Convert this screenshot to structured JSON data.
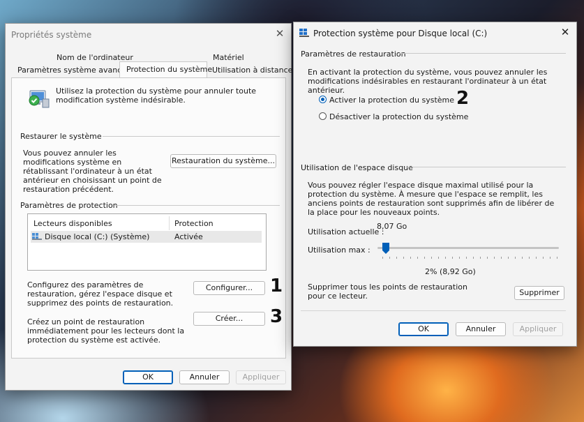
{
  "left_window": {
    "title": "Propriétés système",
    "tabs_row1": [
      "Nom de l'ordinateur",
      "Matériel"
    ],
    "tabs_row2": [
      "Paramètres système avancés",
      "Protection du système",
      "Utilisation à distance"
    ],
    "intro_text": "Utilisez la protection du système pour annuler toute modification système indésirable.",
    "restore_section": {
      "header": "Restaurer le système",
      "text": "Vous pouvez annuler les modifications système en rétablissant l'ordinateur à un état antérieur en choisissant un point de restauration précédent.",
      "button": "Restauration du système..."
    },
    "protection_section": {
      "header": "Paramètres de protection",
      "columns": [
        "Lecteurs disponibles",
        "Protection"
      ],
      "rows": [
        {
          "drive": "Disque local (C:) (Système)",
          "protection": "Activée"
        }
      ]
    },
    "configure_text": "Configurez des paramètres de restauration, gérez l'espace disque et supprimez des points de restauration.",
    "configure_button": "Configurer...",
    "configure_marker": "1",
    "create_text": "Créez un point de restauration immédiatement pour les lecteurs dont la protection du système est activée.",
    "create_button": "Créer...",
    "create_marker": "3",
    "footer": {
      "ok": "OK",
      "cancel": "Annuler",
      "apply": "Appliquer"
    }
  },
  "right_window": {
    "title": "Protection système pour Disque local (C:)",
    "restore_params": {
      "header": "Paramètres de restauration",
      "text": "En activant la protection du système, vous pouvez annuler les modifications indésirables en restaurant l'ordinateur à un état antérieur.",
      "option_on": "Activer la protection du système",
      "option_off": "Désactiver la protection du système",
      "selected": "on",
      "marker": "2"
    },
    "disk_usage": {
      "header": "Utilisation de l'espace disque",
      "text": "Vous pouvez régler l'espace disque maximal utilisé pour la protection du système. À mesure que l'espace se remplit, les anciens points de restauration sont supprimés afin de libérer de la place pour les nouveaux points.",
      "current_label": "Utilisation actuelle :",
      "current_value": "8,07 Go",
      "max_label": "Utilisation max :",
      "max_value": "2% (8,92 Go)",
      "slider_percent": 2
    },
    "delete_text": "Supprimer tous les points de restauration pour ce lecteur.",
    "delete_button": "Supprimer",
    "footer": {
      "ok": "OK",
      "cancel": "Annuler",
      "apply": "Appliquer"
    }
  },
  "colors": {
    "accent": "#005fb8",
    "window_bg": "#f3f3f3"
  }
}
